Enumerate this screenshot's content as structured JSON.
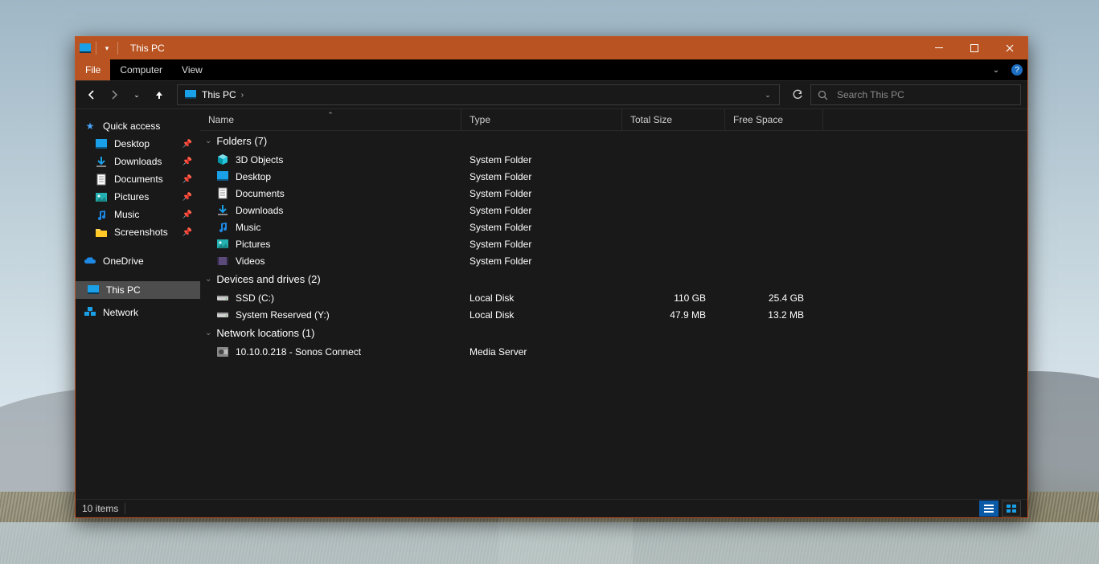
{
  "title": "This PC",
  "ribbon": {
    "file": "File",
    "computer": "Computer",
    "view": "View"
  },
  "breadcrumb": {
    "path": "This PC"
  },
  "search": {
    "placeholder": "Search This PC"
  },
  "columns": {
    "name": "Name",
    "type": "Type",
    "total": "Total Size",
    "free": "Free Space"
  },
  "sidebar": {
    "quick_access": "Quick access",
    "quick_items": [
      {
        "label": "Desktop"
      },
      {
        "label": "Downloads"
      },
      {
        "label": "Documents"
      },
      {
        "label": "Pictures"
      },
      {
        "label": "Music"
      },
      {
        "label": "Screenshots"
      }
    ],
    "onedrive": "OneDrive",
    "thispc": "This PC",
    "network": "Network"
  },
  "groups": {
    "folders": {
      "label": "Folders (7)"
    },
    "drives": {
      "label": "Devices and drives (2)"
    },
    "network": {
      "label": "Network locations (1)"
    }
  },
  "folders": [
    {
      "name": "3D Objects",
      "type": "System Folder"
    },
    {
      "name": "Desktop",
      "type": "System Folder"
    },
    {
      "name": "Documents",
      "type": "System Folder"
    },
    {
      "name": "Downloads",
      "type": "System Folder"
    },
    {
      "name": "Music",
      "type": "System Folder"
    },
    {
      "name": "Pictures",
      "type": "System Folder"
    },
    {
      "name": "Videos",
      "type": "System Folder"
    }
  ],
  "drives": [
    {
      "name": "SSD (C:)",
      "type": "Local Disk",
      "total": "110 GB",
      "free": "25.4 GB"
    },
    {
      "name": "System Reserved (Y:)",
      "type": "Local Disk",
      "total": "47.9 MB",
      "free": "13.2 MB"
    }
  ],
  "netloc": [
    {
      "name": "10.10.0.218 - Sonos Connect",
      "type": "Media Server"
    }
  ],
  "status": {
    "items": "10 items"
  }
}
